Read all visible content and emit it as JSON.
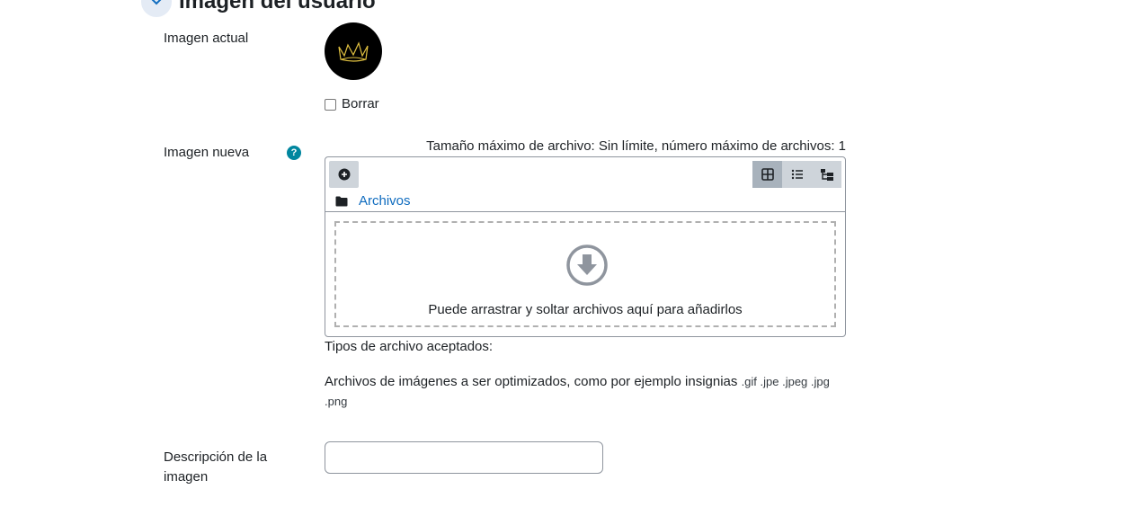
{
  "section": {
    "title": "Imagen del usuario"
  },
  "current_image": {
    "label": "Imagen actual",
    "delete_label": "Borrar"
  },
  "new_image": {
    "label": "Imagen nueva",
    "help_glyph": "?",
    "max_size_text": "Tamaño máximo de archivo: Sin límite, número máximo de archivos: 1",
    "path_folder": "Archivos",
    "drop_text": "Puede arrastrar y soltar archivos aquí para añadirlos",
    "view_modes": [
      "icons",
      "list",
      "tree"
    ],
    "active_view": "icons"
  },
  "accepted_types": {
    "label": "Tipos de archivo aceptados:",
    "description": "Archivos de imágenes a ser optimizados, como por ejemplo insignias",
    "extensions": ".gif .jpe .jpeg .jpg .png"
  },
  "image_description": {
    "label": "Descripción de la imagen",
    "value": ""
  },
  "colors": {
    "link": "#0f6cbf",
    "help_icon": "#00869f",
    "avatar_bg": "#000000",
    "crown": "#e0c040"
  },
  "icons": [
    "chevron-down-icon",
    "help-icon",
    "crown-icon",
    "add-file-icon",
    "grid-view-icon",
    "list-view-icon",
    "tree-view-icon",
    "folder-icon",
    "download-arrow-icon"
  ]
}
